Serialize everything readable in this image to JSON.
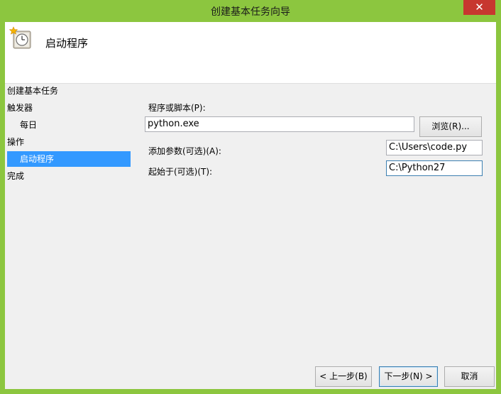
{
  "window": {
    "title": "创建基本任务向导",
    "close_glyph": "✕"
  },
  "header": {
    "icon": "clock-icon",
    "title": "启动程序"
  },
  "nav": {
    "items": [
      {
        "label": "创建基本任务",
        "sub": false,
        "active": false
      },
      {
        "label": "触发器",
        "sub": false,
        "active": false
      },
      {
        "label": "每日",
        "sub": true,
        "active": false
      },
      {
        "label": "操作",
        "sub": false,
        "active": false
      },
      {
        "label": "启动程序",
        "sub": true,
        "active": true
      },
      {
        "label": "完成",
        "sub": false,
        "active": false
      }
    ]
  },
  "form": {
    "program_label": "程序或脚本(P):",
    "program_value": "python.exe",
    "browse_label": "浏览(R)...",
    "args_label": "添加参数(可选)(A):",
    "args_value": "C:\\Users\\code.py",
    "start_label": "起始于(可选)(T):",
    "start_value": "C:\\Python27"
  },
  "footer": {
    "back_label": "< 上一步(B)",
    "next_label": "下一步(N) >",
    "cancel_label": "取消"
  },
  "colors": {
    "frame": "#8cc63f",
    "selection": "#3399ff",
    "close": "#c7372f"
  }
}
